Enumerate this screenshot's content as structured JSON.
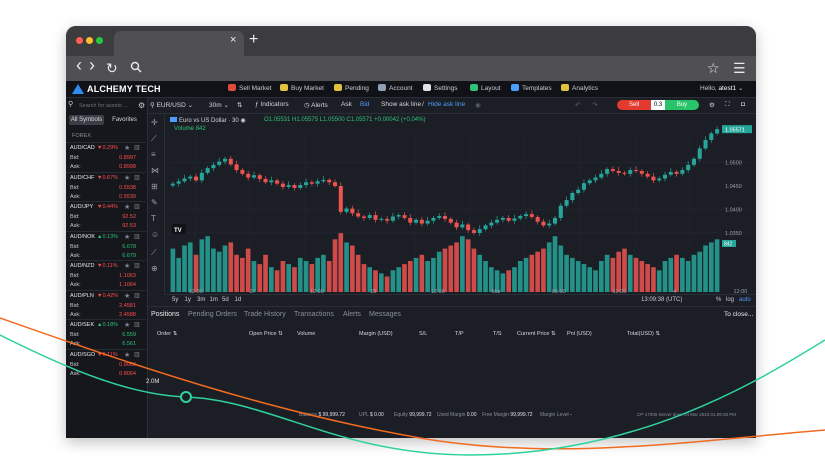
{
  "browser": {
    "tab_close": "×",
    "new_tab": "+",
    "nav_back": "‹",
    "nav_forward": "›",
    "reload": "↻",
    "search_icon": "search-icon",
    "star": "☆",
    "menu": "☰",
    "traffic_lights": [
      "#ff5f57",
      "#febc2e",
      "#28c840"
    ]
  },
  "app": {
    "brand": "ALCHEMY TECH",
    "menu": [
      "Sell Market",
      "Buy Market",
      "Pending",
      "Account",
      "Settings",
      "Layout",
      "Templates",
      "Analytics"
    ],
    "menu_icon_colors": [
      "#e04b3c",
      "#e0c23c",
      "#e0c23c",
      "#8ea0b8",
      "#dfe2e8",
      "#2fc178",
      "#4c9dff",
      "#e0c23c"
    ],
    "hello_prefix": "Hello,",
    "username": "atest1"
  },
  "sidebar": {
    "search_placeholder": "Search for assets ...",
    "tabs": [
      "All Symbols",
      "Favorites"
    ],
    "section": "FOREX",
    "symbols": [
      {
        "name": "AUD/CAD",
        "change": "▼0.29%",
        "bid": "0.8997",
        "ask": "0.8998",
        "change_color": "#ff4d4d"
      },
      {
        "name": "AUD/CHF",
        "change": "▼0.67%",
        "bid": "0.5538",
        "ask": "0.5539",
        "change_color": "#ff4d4d"
      },
      {
        "name": "AUD/JPY",
        "change": "▼0.44%",
        "bid": "92.52",
        "ask": "92.53",
        "change_color": "#ff4d4d"
      },
      {
        "name": "AUD/NOK",
        "change": "▲0.13%",
        "bid": "6.678",
        "ask": "6.679",
        "change_color": "#2fc178"
      },
      {
        "name": "AUD/NZD",
        "change": "▼0.11%",
        "bid": "1.1063",
        "ask": "1.1064",
        "change_color": "#ff4d4d"
      },
      {
        "name": "AUD/PLN",
        "change": "▼0.42%",
        "bid": "2.4581",
        "ask": "2.4588",
        "change_color": "#ff4d4d"
      },
      {
        "name": "AUD/SEK",
        "change": "▲0.18%",
        "bid": "6.559",
        "ask": "6.561",
        "change_color": "#2fc178"
      },
      {
        "name": "AUD/SGD",
        "change": "▼0.11%",
        "bid": "0.8063",
        "ask": "0.8064",
        "change_color": "#ff4d4d"
      }
    ],
    "bid_label": "Bid:",
    "ask_label": "Ask:"
  },
  "toolbar": {
    "symbol": "EUR/USD",
    "timeframe": "30m",
    "indicators": "Indicators",
    "alerts": "Alerts",
    "ask": "Ask",
    "bid": "Bid",
    "show_ask_line": "Show ask line",
    "separator": "/",
    "hide_ask_line": "Hide ask line",
    "sell": "Sell",
    "quantity": "0.3",
    "buy": "Buy"
  },
  "chart": {
    "title": "Euro vs US Dollar · 30",
    "ohlc": "O1.05531 H1.05575 L1.05500 C1.05571 +0.00042 (+0.04%)",
    "volume_label": "Volume",
    "volume_value": "842",
    "price_label": "1.05571",
    "volume_axis_label": "842",
    "tv_badge": "TV"
  },
  "chart_data": {
    "type": "candlestick",
    "x_tick_labels": [
      "12:00",
      "27",
      "12:00",
      "28",
      "12:00",
      "Mar",
      "05:00",
      "12:00",
      "4",
      "12:00"
    ],
    "y_tick_labels": [
      "1.05571",
      "1.0500",
      "1.0450",
      "1.0400",
      "1.0350"
    ],
    "y_range": [
      1.0335,
      1.0565
    ],
    "close": [
      1.0455,
      1.046,
      1.0466,
      1.047,
      1.0462,
      1.0478,
      1.0488,
      1.0495,
      1.0502,
      1.0508,
      1.0496,
      1.0484,
      1.0476,
      1.0468,
      1.0473,
      1.0465,
      1.0458,
      1.0462,
      1.0455,
      1.0448,
      1.0452,
      1.0446,
      1.0452,
      1.0458,
      1.0455,
      1.046,
      1.0463,
      1.0458,
      1.045,
      1.0395,
      1.0402,
      1.0392,
      1.0385,
      1.0382,
      1.0388,
      1.0378,
      1.038,
      1.0376,
      1.0385,
      1.0388,
      1.0382,
      1.0372,
      1.0378,
      1.037,
      1.0376,
      1.0382,
      1.0386,
      1.038,
      1.0372,
      1.0362,
      1.0368,
      1.0356,
      1.035,
      1.0358,
      1.0366,
      1.0372,
      1.0378,
      1.0382,
      1.0376,
      1.0381,
      1.0386,
      1.039,
      1.0384,
      1.0374,
      1.0366,
      1.037,
      1.0382,
      1.0408,
      1.042,
      1.0435,
      1.0442,
      1.0456,
      1.0462,
      1.0468,
      1.0476,
      1.0486,
      1.0482,
      1.0478,
      1.0476,
      1.0484,
      1.0482,
      1.0476,
      1.047,
      1.0462,
      1.0466,
      1.0474,
      1.048,
      1.0476,
      1.0484,
      1.0495,
      1.0508,
      1.053,
      1.0548,
      1.0562,
      1.0571
    ],
    "volume": [
      0.7,
      0.55,
      0.75,
      0.8,
      0.6,
      0.85,
      0.9,
      0.7,
      0.65,
      0.75,
      0.8,
      0.6,
      0.55,
      0.7,
      0.5,
      0.45,
      0.6,
      0.4,
      0.35,
      0.5,
      0.45,
      0.4,
      0.55,
      0.5,
      0.45,
      0.55,
      0.6,
      0.5,
      0.85,
      0.95,
      0.8,
      0.75,
      0.6,
      0.45,
      0.4,
      0.35,
      0.3,
      0.25,
      0.35,
      0.4,
      0.45,
      0.5,
      0.55,
      0.6,
      0.5,
      0.55,
      0.65,
      0.7,
      0.75,
      0.8,
      0.9,
      0.85,
      0.7,
      0.6,
      0.5,
      0.4,
      0.35,
      0.3,
      0.35,
      0.4,
      0.5,
      0.55,
      0.6,
      0.65,
      0.7,
      0.8,
      0.9,
      0.75,
      0.6,
      0.55,
      0.5,
      0.45,
      0.4,
      0.35,
      0.5,
      0.6,
      0.55,
      0.65,
      0.7,
      0.6,
      0.55,
      0.5,
      0.45,
      0.4,
      0.35,
      0.5,
      0.55,
      0.6,
      0.55,
      0.5,
      0.6,
      0.65,
      0.75,
      0.8,
      0.85
    ],
    "up_color": "#26a69a",
    "down_color": "#ef5350"
  },
  "timeframes": {
    "options": [
      "5y",
      "1y",
      "3m",
      "1m",
      "5d",
      "1d"
    ],
    "time": "13:09:38 (UTC)",
    "percent": "%",
    "log": "log",
    "auto": "auto"
  },
  "positions": {
    "tabs": [
      "Positions",
      "Pending Orders",
      "Trade History",
      "Transactions",
      "Alerts",
      "Messages"
    ],
    "to_close": "To close...",
    "columns": [
      "Order ⇅",
      "Open Price ⇅",
      "Volume",
      "Margin (USD)",
      "S/L",
      "T/P",
      "T/S",
      "Current Price ⇅",
      "Pnl (USD)",
      "Total(USD) ⇅"
    ]
  },
  "status": {
    "balance_label": "Balance",
    "balance": "$ 99,999.72",
    "upl_label": "UPL",
    "upl": "$ 0.00",
    "equity_label": "Equity",
    "equity": "99,999.72",
    "used_margin_label": "Used Margin",
    "used_margin": "0.00",
    "free_margin_label": "Free Margin",
    "free_margin": "99,999.72",
    "margin_level_label": "Margin Level",
    "margin_level": "-",
    "server": "CP-17000 Server time: 04 Mar 2023 01:09:38 PM"
  },
  "overlay": {
    "zoom": "2.0M",
    "orange_curve": "#f26b21",
    "green_curve": "#2fd29c"
  }
}
